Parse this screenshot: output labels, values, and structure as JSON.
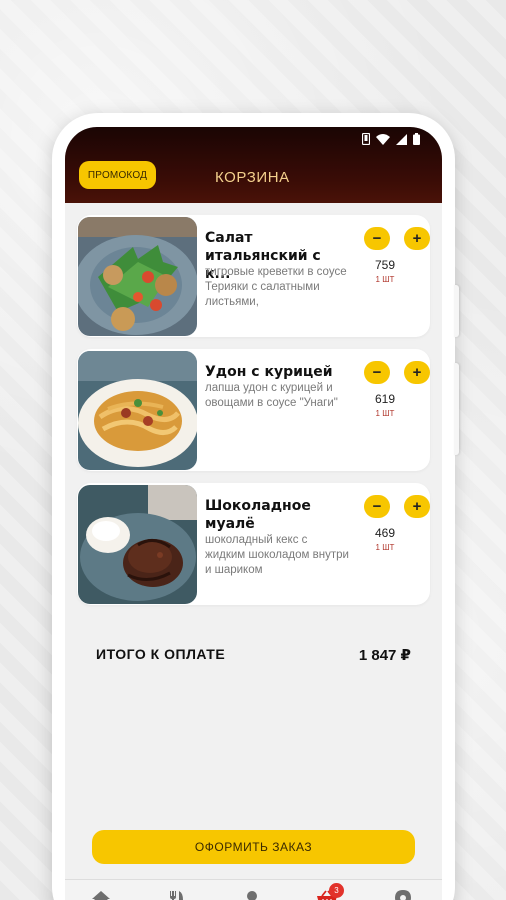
{
  "header": {
    "promo_label": "ПРОМОКОД",
    "title": "КОРЗИНА"
  },
  "status_icons": [
    "phone-icon",
    "wifi-icon",
    "signal-icon",
    "battery-icon"
  ],
  "cart": {
    "items": [
      {
        "name": "Салат итальянский с к...",
        "description": "тигровые креветки в соусе Терияки с салатными листьями,",
        "price": "759",
        "quantity": "1 ШТ",
        "image": "salad-image"
      },
      {
        "name": "Удон с курицей",
        "description": "лапша удон с курицей и овощами в соусе \"Унаги\"",
        "price": "619",
        "quantity": "1 ШТ",
        "image": "udon-image"
      },
      {
        "name": "Шоколадное муалё",
        "description": "шоколадный кекс с жидким шоколадом внутри и шариком",
        "price": "469",
        "quantity": "1 ШТ",
        "image": "fondant-image"
      }
    ],
    "minus_label": "−",
    "plus_label": "+"
  },
  "total": {
    "label": "ИТОГО К ОПЛАТЕ",
    "value": "1 847 ₽"
  },
  "order_button": "ОФОРМИТЬ ЗАКАЗ",
  "tabbar": {
    "items": [
      "home-icon",
      "menu-icon",
      "profile-icon",
      "basket-icon",
      "location-icon"
    ],
    "cart_badge": "3"
  },
  "colors": {
    "accent": "#f7c600",
    "header_dark": "#2a0805",
    "title_gold": "#f3d08c",
    "quantity_red": "#b0352b",
    "badge_red": "#e2322b"
  }
}
